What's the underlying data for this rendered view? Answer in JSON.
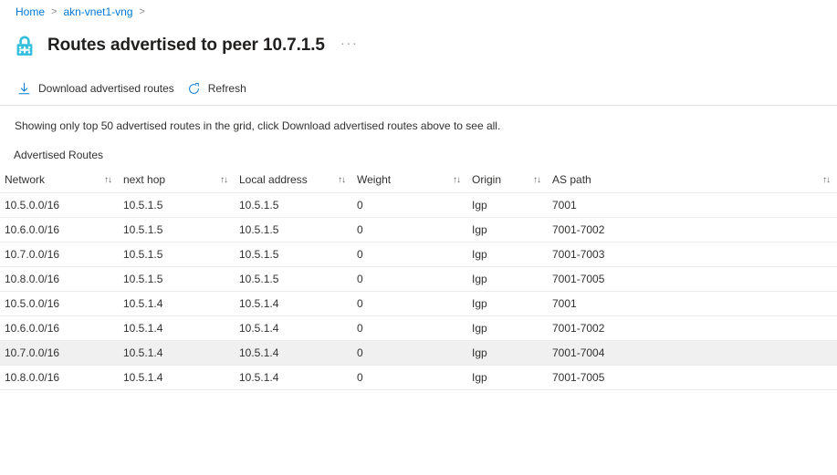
{
  "breadcrumb": {
    "items": [
      {
        "label": "Home"
      },
      {
        "label": "akn-vnet1-vng"
      }
    ],
    "separator": ">"
  },
  "header": {
    "icon": "vpn-gateway-lock-icon",
    "title": "Routes advertised to peer 10.7.1.5",
    "more_menu": "···"
  },
  "command_bar": {
    "buttons": [
      {
        "label": "Download advertised routes",
        "icon": "download-icon"
      },
      {
        "label": "Refresh",
        "icon": "refresh-icon"
      }
    ]
  },
  "notice": {
    "text": "Showing only top 50 advertised routes in the grid, click Download advertised routes above to see all."
  },
  "grid": {
    "caption": "Advertised Routes",
    "sort_glyph": "↑↓",
    "columns": [
      {
        "label": "Network",
        "sortable": true
      },
      {
        "label": "next hop",
        "sortable": true
      },
      {
        "label": "Local address",
        "sortable": true
      },
      {
        "label": "Weight",
        "sortable": true
      },
      {
        "label": "Origin",
        "sortable": true
      },
      {
        "label": "AS path",
        "sortable": true
      }
    ],
    "rows": [
      {
        "network": "10.5.0.0/16",
        "next_hop": "10.5.1.5",
        "local_address": "10.5.1.5",
        "weight": "0",
        "origin": "Igp",
        "as_path": "7001",
        "selected": false
      },
      {
        "network": "10.6.0.0/16",
        "next_hop": "10.5.1.5",
        "local_address": "10.5.1.5",
        "weight": "0",
        "origin": "Igp",
        "as_path": "7001-7002",
        "selected": false
      },
      {
        "network": "10.7.0.0/16",
        "next_hop": "10.5.1.5",
        "local_address": "10.5.1.5",
        "weight": "0",
        "origin": "Igp",
        "as_path": "7001-7003",
        "selected": false
      },
      {
        "network": "10.8.0.0/16",
        "next_hop": "10.5.1.5",
        "local_address": "10.5.1.5",
        "weight": "0",
        "origin": "Igp",
        "as_path": "7001-7005",
        "selected": false
      },
      {
        "network": "10.5.0.0/16",
        "next_hop": "10.5.1.4",
        "local_address": "10.5.1.4",
        "weight": "0",
        "origin": "Igp",
        "as_path": "7001",
        "selected": false
      },
      {
        "network": "10.6.0.0/16",
        "next_hop": "10.5.1.4",
        "local_address": "10.5.1.4",
        "weight": "0",
        "origin": "Igp",
        "as_path": "7001-7002",
        "selected": false
      },
      {
        "network": "10.7.0.0/16",
        "next_hop": "10.5.1.4",
        "local_address": "10.5.1.4",
        "weight": "0",
        "origin": "Igp",
        "as_path": "7001-7004",
        "selected": true
      },
      {
        "network": "10.8.0.0/16",
        "next_hop": "10.5.1.4",
        "local_address": "10.5.1.4",
        "weight": "0",
        "origin": "Igp",
        "as_path": "7001-7005",
        "selected": false
      }
    ]
  },
  "colors": {
    "link": "#0078d4",
    "text": "#323130",
    "border": "#edebe9",
    "divider": "#e1dfdd",
    "selected_row": "#f0f0f0",
    "icon_accent": "#32bedd"
  }
}
